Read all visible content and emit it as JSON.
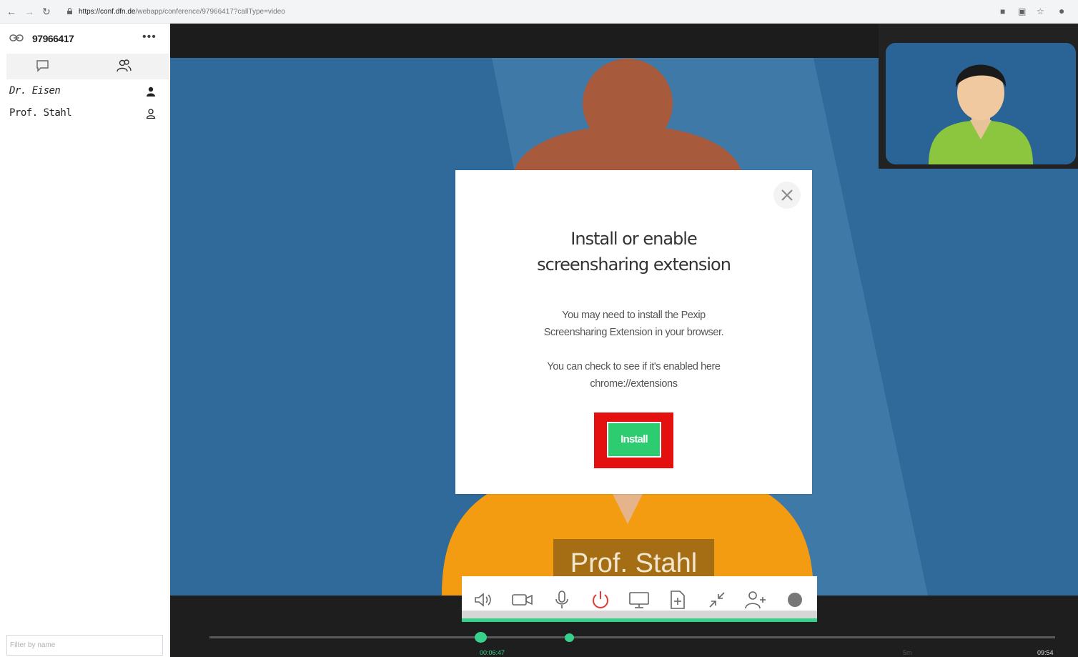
{
  "browser": {
    "url_host": "https://conf.dfn.de",
    "url_path": "/webapp/conference/97966417?callType=video"
  },
  "sidebar": {
    "conference_id": "97966417",
    "filter_placeholder": "Filter by name",
    "participants": [
      {
        "name": "Dr. Eisen",
        "icon": "user-filled-icon"
      },
      {
        "name": "Prof. Stahl",
        "icon": "user-outline-icon"
      }
    ]
  },
  "video": {
    "name_tag": "Prof. Stahl",
    "colors": {
      "background": "#2f6a9a",
      "accent": "#36d28b"
    }
  },
  "modal": {
    "title_line1": "Install or enable",
    "title_line2": "screensharing extension",
    "text1_line1": "You may need to install the Pexip",
    "text1_line2": "Screensharing Extension in your browser.",
    "text2_line1": "You can check to see if it's enabled here",
    "text2_line2": "chrome://extensions",
    "install_label": "Install"
  },
  "toolbar": {
    "icons": [
      "speaker-icon",
      "camera-icon",
      "microphone-icon",
      "power-icon",
      "screenshare-icon",
      "share-file-icon",
      "minimize-icon",
      "add-participant-icon",
      "record-icon"
    ]
  },
  "timeline": {
    "current_time": "00:06:47",
    "mid_label": "5m",
    "end_time": "09:54"
  }
}
